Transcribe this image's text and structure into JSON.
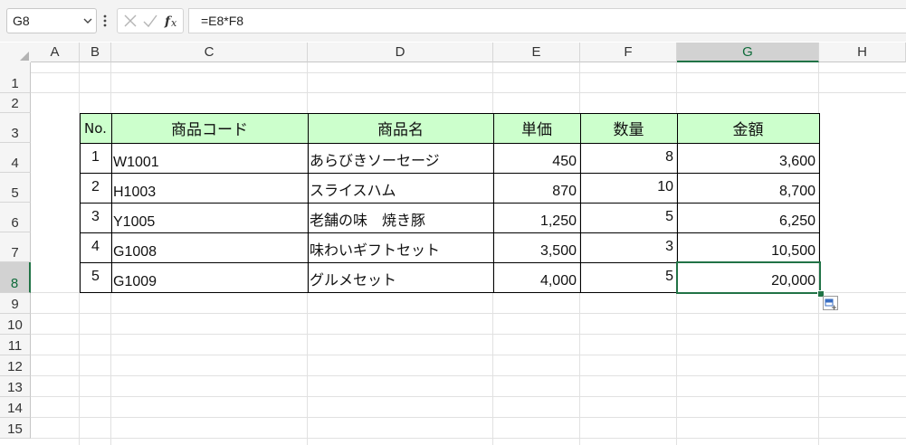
{
  "name_box": {
    "value": "G8"
  },
  "formula_bar": {
    "value": "=E8*F8"
  },
  "columns": [
    "A",
    "B",
    "C",
    "D",
    "E",
    "F",
    "G",
    "H"
  ],
  "selected_column": "G",
  "rows": [
    "1",
    "2",
    "3",
    "4",
    "5",
    "6",
    "7",
    "8",
    "9",
    "10",
    "11",
    "12",
    "13",
    "14",
    "15"
  ],
  "selected_row": "8",
  "table": {
    "headers": [
      "No.",
      "商品コード",
      "商品名",
      "単価",
      "数量",
      "金額"
    ],
    "header_color": "#ccffcc",
    "rows": [
      {
        "no": "1",
        "code": "W1001",
        "name": "あらびきソーセージ",
        "price": "450",
        "qty": "8",
        "amount": "3,600"
      },
      {
        "no": "2",
        "code": "H1003",
        "name": "スライスハム",
        "price": "870",
        "qty": "10",
        "amount": "8,700"
      },
      {
        "no": "3",
        "code": "Y1005",
        "name": "老舗の味　焼き豚",
        "price": "1,250",
        "qty": "5",
        "amount": "6,250"
      },
      {
        "no": "4",
        "code": "G1008",
        "name": "味わいギフトセット",
        "price": "3,500",
        "qty": "3",
        "amount": "10,500"
      },
      {
        "no": "5",
        "code": "G1009",
        "name": "グルメセット",
        "price": "4,000",
        "qty": "5",
        "amount": "20,000"
      }
    ]
  },
  "selection_color": "#217346",
  "icons": {
    "namebox_dropdown": "chevron-down-icon",
    "more": "vertical-ellipsis-icon",
    "cancel": "cancel-icon",
    "enter": "check-icon",
    "insert_function": "function-icon",
    "select_all": "select-all-icon",
    "quick_analysis": "quick-analysis-icon"
  }
}
